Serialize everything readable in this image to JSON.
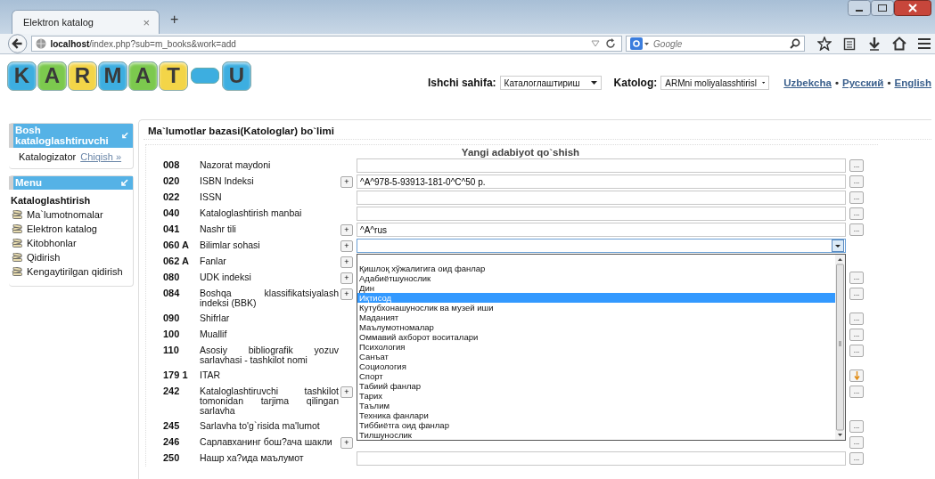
{
  "browser": {
    "tabs": [
      {
        "title": "Elektron katalog",
        "selected": true,
        "close": "×"
      }
    ],
    "new_tab": "+",
    "url": "**localhost**/index.php?sub=m_books&work=add",
    "search": {
      "placeholder": "Google"
    }
  },
  "logo": [
    {
      "kind": "letter",
      "text": "K",
      "color": "#3daee0"
    },
    {
      "kind": "letter",
      "text": "A",
      "color": "#7cc94e"
    },
    {
      "kind": "letter",
      "text": "R",
      "color": "#f3d548"
    },
    {
      "kind": "letter",
      "text": "M",
      "color": "#3daee0"
    },
    {
      "kind": "letter",
      "text": "A",
      "color": "#7cc94e"
    },
    {
      "kind": "letter",
      "text": "T",
      "color": "#f3d548"
    },
    {
      "kind": "dash",
      "color": "#3daee0"
    },
    {
      "kind": "letter",
      "text": "U",
      "color": "#3daee0"
    }
  ],
  "header": {
    "workspace": {
      "label": "Ishchi sahifa:",
      "value": "Каталоглаштириш"
    },
    "catalog": {
      "label": "Katolog:",
      "value": "ARMni moliyalasshtirisl"
    },
    "languages": [
      "Uzbekcha",
      "Русский",
      "English"
    ],
    "separator": "•"
  },
  "sidebar": {
    "user_panel": {
      "title": "Bosh kataloglashtiruvchi",
      "user": "Katalogizator",
      "logout": "Chiqish »"
    },
    "menu": {
      "title": "Menu",
      "section": "Kataloglashtirish",
      "items": [
        "Ma`lumotnomalar",
        "Elektron katalog",
        "Kitobhonlar",
        "Qidirish",
        "Kengaytirilgan qidirish"
      ]
    }
  },
  "main": {
    "title": "Ma`lumotlar bazasi(Katologlar) bo`limi",
    "form_title": "Yangi adabiyot qo`shish",
    "rows": [
      {
        "code": "008",
        "label": "Nazorat maydoni",
        "kind": "text",
        "action": {
          "kind": "text",
          "label": "..."
        }
      },
      {
        "code": "020",
        "label": "ISBN Indeksi",
        "add": "+",
        "kind": "text",
        "value": "^A^978-5-93913-181-0^C^50 р.",
        "action": {
          "kind": "text",
          "label": "..."
        }
      },
      {
        "code": "022",
        "label": "ISSN",
        "kind": "text",
        "action": {
          "kind": "text",
          "label": "..."
        }
      },
      {
        "code": "040",
        "label": "Kataloglashtirish manbai",
        "kind": "text",
        "action": {
          "kind": "text",
          "label": "..."
        }
      },
      {
        "code": "041",
        "label": "Nashr tili",
        "add": "+",
        "kind": "text",
        "value": "^A^rus",
        "action": {
          "kind": "text",
          "label": "..."
        }
      },
      {
        "code": "060 A",
        "label": "Bilimlar sohasi",
        "add": "+",
        "kind": "select",
        "expanded": true,
        "options": [
          {
            "text": "Қишлоқ хўжалигига оид фанлар",
            "selected": false
          },
          {
            "text": "Адабиётшунослик",
            "selected": false
          },
          {
            "text": "Дин",
            "selected": false
          },
          {
            "text": "Иқтисод",
            "selected": true
          },
          {
            "text": "Кутубхонашунослик ва музей иши",
            "selected": false
          },
          {
            "text": "Маданият",
            "selected": false
          },
          {
            "text": "Маълумотномалар",
            "selected": false
          },
          {
            "text": "Оммавий ахборот воситалари",
            "selected": false
          },
          {
            "text": "Психология",
            "selected": false
          },
          {
            "text": "Санъат",
            "selected": false
          },
          {
            "text": "Социология",
            "selected": false
          },
          {
            "text": "Спорт",
            "selected": false
          },
          {
            "text": "Табиий фанлар",
            "selected": false
          },
          {
            "text": "Тарих",
            "selected": false
          },
          {
            "text": "Таълим",
            "selected": false
          },
          {
            "text": "Техника фанлари",
            "selected": false
          },
          {
            "text": "Тиббиётга оид фанлар",
            "selected": false
          },
          {
            "text": "Тилшунослик",
            "selected": false
          }
        ]
      },
      {
        "code": "062 A",
        "label": "Fanlar",
        "add": "+",
        "kind": "covered"
      },
      {
        "code": "080",
        "label": "UDK indeksi",
        "add": "+",
        "kind": "covered",
        "action": {
          "kind": "text",
          "label": "..."
        }
      },
      {
        "code": "084",
        "label": "Boshqa klassifikatsiyalash indeksi (BBK)",
        "add": "+",
        "kind": "covered",
        "action": {
          "kind": "text",
          "label": "..."
        }
      },
      {
        "code": "090",
        "label": "Shifrlar",
        "kind": "covered",
        "action": {
          "kind": "text",
          "label": "..."
        }
      },
      {
        "code": "100",
        "label": "Muallif",
        "kind": "covered",
        "action": {
          "kind": "text",
          "label": "..."
        }
      },
      {
        "code": "110",
        "label": "Asosiy bibliografik yozuv sarlavhasi - tashkilot nomi",
        "kind": "covered",
        "action": {
          "kind": "text",
          "label": "..."
        }
      },
      {
        "code": "179 1",
        "label": "ITAR",
        "kind": "covered",
        "action": {
          "kind": "arrow"
        }
      },
      {
        "code": "242",
        "label": "Kataloglashtiruvchi tashkilot tomonidan tarjima qilingan sarlavha",
        "add": "+",
        "kind": "covered",
        "action": {
          "kind": "text",
          "label": "..."
        }
      },
      {
        "code": "245",
        "label": "Sarlavha to'g`risida ma'lumot",
        "kind": "covered",
        "action": {
          "kind": "text",
          "label": "..."
        }
      },
      {
        "code": "246",
        "label": "Сарлавханинг бош?ача шакли",
        "add": "+",
        "kind": "covered",
        "action": {
          "kind": "text",
          "label": "..."
        }
      },
      {
        "code": "250",
        "label": "Нашр ха?ида маълумот",
        "kind": "text",
        "action": {
          "kind": "text",
          "label": "..."
        }
      }
    ]
  }
}
